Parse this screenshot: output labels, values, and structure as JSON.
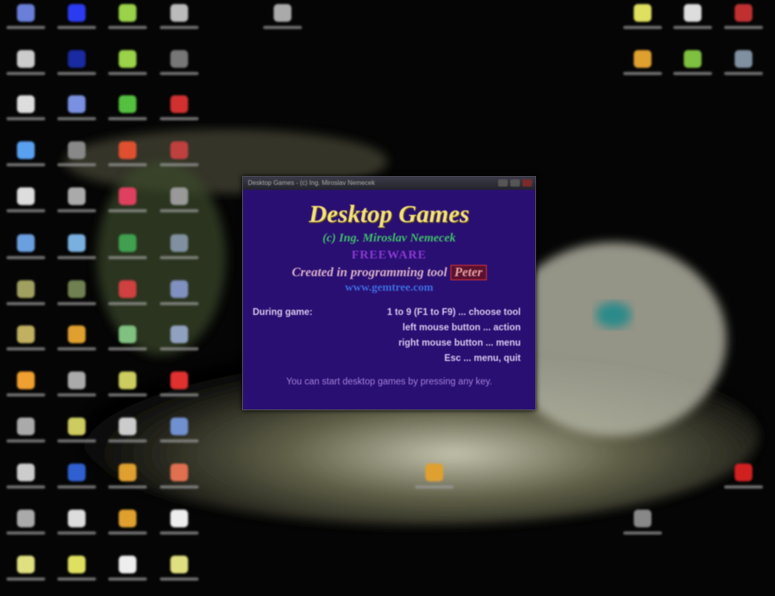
{
  "dialog": {
    "window_title": "Desktop Games - (c) Ing. Miroslav Nemecek",
    "heading": "Desktop Games",
    "author": "(c) Ing. Miroslav Nemecek",
    "license": "FREEWARE",
    "created_prefix": "Created in programming tool",
    "tool_name": "Peter",
    "website": "www.gemtree.com",
    "keys_label": "During game:",
    "keys": [
      {
        "key": "1 to 9 (F1 to F9)",
        "action": "choose tool"
      },
      {
        "key": "left mouse button",
        "action": "action"
      },
      {
        "key": "right mouse button",
        "action": "menu"
      },
      {
        "key": "Esc",
        "action": "menu, quit"
      }
    ],
    "footer": "You can start desktop games by pressing any key."
  },
  "desktop_icons": [
    {
      "color": "#6a7fd8"
    },
    {
      "color": "#2b3cf0"
    },
    {
      "color": "#9ad24a"
    },
    {
      "color": "#bbbbbb"
    },
    {
      "color": "#cccccc"
    },
    {
      "color": "#1a2aa0"
    },
    {
      "color": "#9ad24a"
    },
    {
      "color": "#777777"
    },
    {
      "color": "#dddddd"
    },
    {
      "color": "#7a90e0"
    },
    {
      "color": "#55c040"
    },
    {
      "color": "#d03030"
    },
    {
      "color": "#5aa0f0"
    },
    {
      "color": "#888888"
    },
    {
      "color": "#e05030"
    },
    {
      "color": "#c04040"
    },
    {
      "color": "#dddddd"
    },
    {
      "color": "#aaaaaa"
    },
    {
      "color": "#e04060"
    },
    {
      "color": "#999999"
    },
    {
      "color": "#6aa0e0"
    },
    {
      "color": "#7ab0e0"
    },
    {
      "color": "#40a050"
    },
    {
      "color": "#8090a0"
    },
    {
      "color": "#a0a060"
    },
    {
      "color": "#708050"
    },
    {
      "color": "#d04040"
    },
    {
      "color": "#8090c0"
    },
    {
      "color": "#c0b060"
    },
    {
      "color": "#e0a030"
    },
    {
      "color": "#80c080"
    },
    {
      "color": "#90a0c0"
    },
    {
      "color": "#f0a030"
    },
    {
      "color": "#aaaaaa"
    },
    {
      "color": "#cccc60"
    },
    {
      "color": "#e03030"
    },
    {
      "color": "#aaaaaa"
    },
    {
      "color": "#cccc60"
    },
    {
      "color": "#cccccc"
    },
    {
      "color": "#7090d0"
    },
    {
      "color": "#cccccc"
    },
    {
      "color": "#3060d0"
    },
    {
      "color": "#e0a030"
    },
    {
      "color": "#e07050"
    },
    {
      "color": "#aaaaaa"
    },
    {
      "color": "#dddddd"
    },
    {
      "color": "#e0a030"
    },
    {
      "color": "#eeeeee"
    },
    {
      "color": "#e0e080"
    },
    {
      "color": "#e0e060"
    },
    {
      "color": "#eeeeee"
    },
    {
      "color": "#e0e080"
    },
    {
      "color": "#e0e060"
    },
    {
      "color": "#dddddd"
    },
    {
      "color": "#c03030"
    },
    {
      "color": "#e0a030"
    },
    {
      "color": "#80c040"
    },
    {
      "color": "#8090a0"
    },
    {
      "color": "#aaaaaa"
    },
    {
      "color": "#e0a030"
    },
    {
      "color": "#d02020"
    },
    {
      "color": "#888888"
    }
  ]
}
